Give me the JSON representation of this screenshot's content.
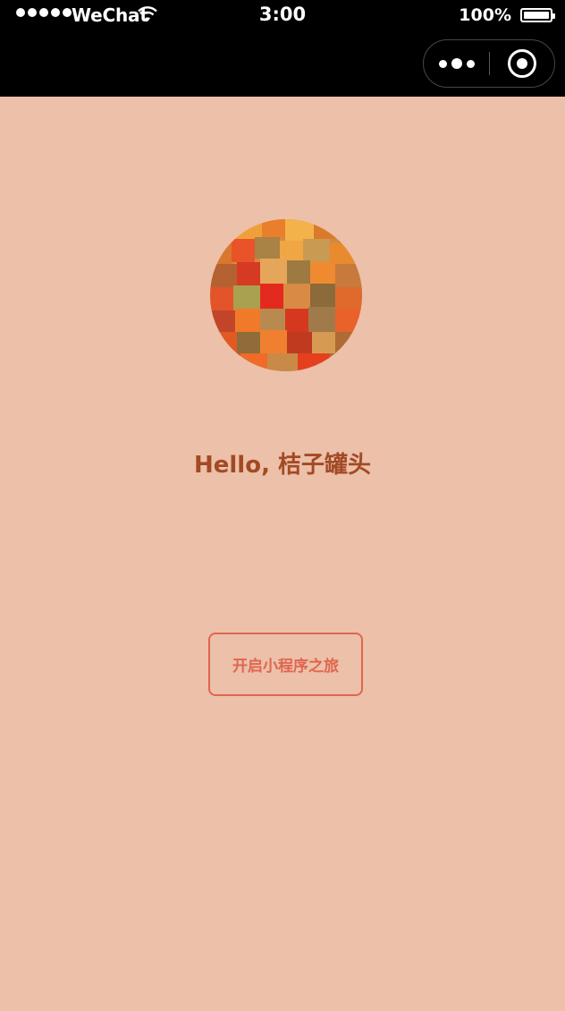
{
  "status_bar": {
    "carrier": "WeChat",
    "time": "3:00",
    "battery_percent": "100%"
  },
  "capsule": {
    "menu_icon": "more-dots-icon",
    "close_icon": "target-close-icon"
  },
  "main": {
    "greeting": "Hello, 桔子罐头",
    "start_button_label": "开启小程序之旅"
  },
  "colors": {
    "page_background": "#ecc0a9",
    "greeting_text": "#a24a25",
    "button_accent": "#e0664f",
    "topbar": "#000000"
  }
}
